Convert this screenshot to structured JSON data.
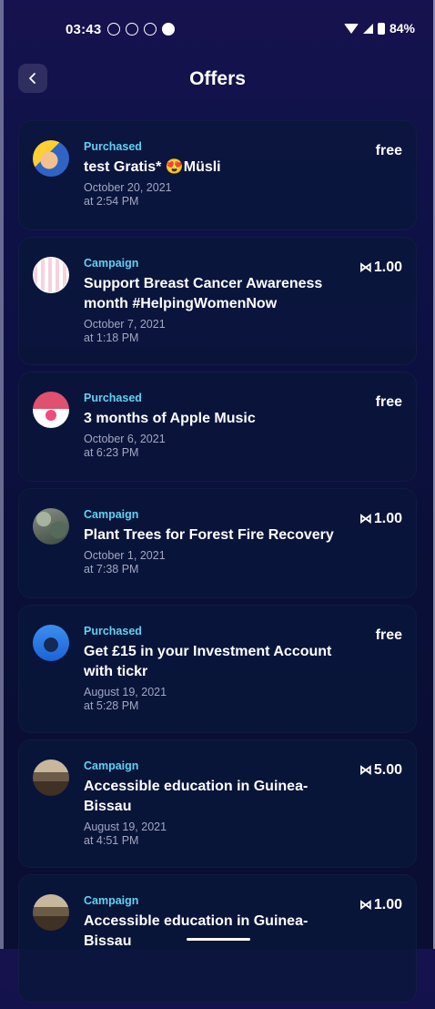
{
  "status_bar": {
    "time": "03:43",
    "battery": "84%"
  },
  "header": {
    "title": "Offers",
    "back_icon": "chevron-left-icon"
  },
  "offers": [
    {
      "kind": "Purchased",
      "title": "test Gratis* 😍Müsli",
      "date": "October 20, 2021",
      "time": "at 2:54 PM",
      "price": "free",
      "coin": false
    },
    {
      "kind": "Campaign",
      "title": "Support Breast Cancer Awareness month #HelpingWomenNow",
      "date": "October 7, 2021",
      "time": "at 1:18 PM",
      "price": "1.00",
      "coin": true
    },
    {
      "kind": "Purchased",
      "title": "3 months of Apple Music",
      "date": "October 6, 2021",
      "time": "at 6:23 PM",
      "price": "free",
      "coin": false
    },
    {
      "kind": "Campaign",
      "title": "Plant Trees for Forest Fire Recovery",
      "date": "October 1, 2021",
      "time": "at 7:38 PM",
      "price": "1.00",
      "coin": true
    },
    {
      "kind": "Purchased",
      "title": "Get £15 in your Investment Account with tickr",
      "date": "August 19, 2021",
      "time": "at 5:28 PM",
      "price": "free",
      "coin": false
    },
    {
      "kind": "Campaign",
      "title": "Accessible education in Guinea-Bissau",
      "date": "August 19, 2021",
      "time": "at 4:51 PM",
      "price": "5.00",
      "coin": true
    },
    {
      "kind": "Campaign",
      "title": "Accessible education in Guinea-Bissau",
      "date": "",
      "time": "",
      "price": "1.00",
      "coin": true
    }
  ],
  "colors": {
    "accent": "#5fd2f3",
    "background": "#0e1146",
    "card": "#0a163a",
    "muted_text": "#a2a7c2"
  }
}
